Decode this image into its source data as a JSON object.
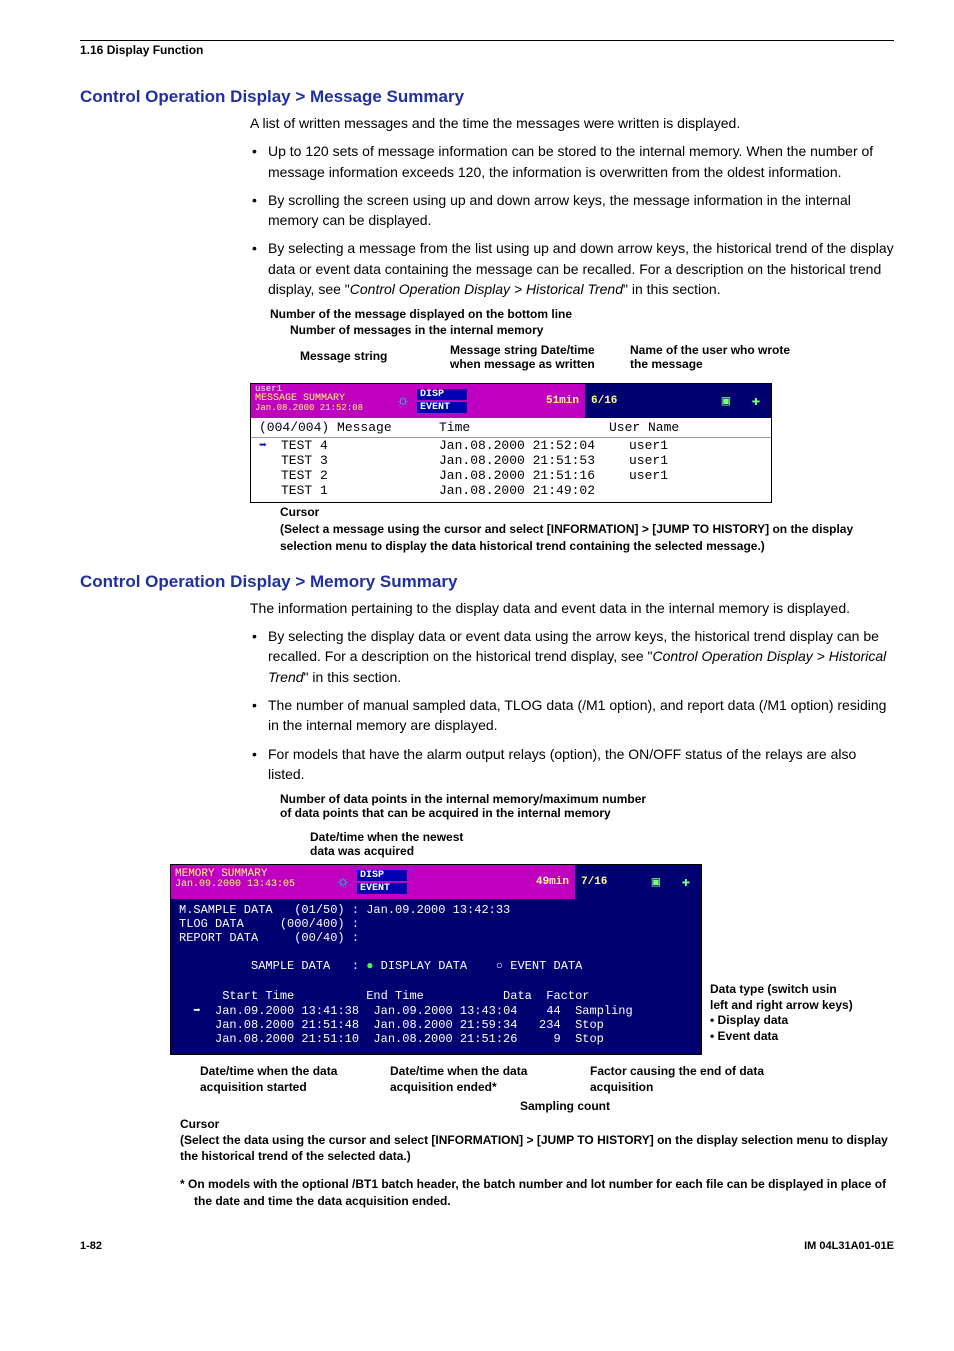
{
  "header": {
    "section": "1.16  Display Function"
  },
  "msg": {
    "heading": "Control Operation Display > Message Summary",
    "intro": "A list of written messages and the time the messages were written is displayed.",
    "bullets": [
      "Up to 120 sets of message information can be stored to the internal memory.  When the number of message information exceeds 120, the information is overwritten from the oldest information.",
      "By scrolling the screen using up and down arrow keys, the message information in the internal memory can be displayed.",
      "By selecting a message from the list using up and down arrow keys, the historical trend of the display data or event data containing the message can be recalled.  For a description on the historical trend display, see \""
    ],
    "bullet3_ital": "Control Operation Display > Historical Trend",
    "bullet3_tail": "\" in this section.",
    "cap1": "Number of the message displayed on the bottom line",
    "cap2": "Number of messages in the internal memory",
    "lbl_msgstr": "Message string",
    "lbl_dt1": "Message string Date/time",
    "lbl_dt2": "when message as written",
    "lbl_user1": "Name of the user who wrote",
    "lbl_user2": "the message",
    "strip": {
      "user": "user1",
      "title": "MESSAGE SUMMARY",
      "ts": "Jan.08.2000 21:52:08",
      "disp": "DISP",
      "event": "EVENT",
      "elapsed": "51min",
      "page": "6/16"
    },
    "cols": {
      "c1": "(004/004) Message",
      "c2": "Time",
      "c3": "User Name"
    },
    "rows": [
      {
        "arrow": "➡",
        "m": "TEST 4",
        "t": "Jan.08.2000 21:52:04",
        "u": "user1"
      },
      {
        "arrow": "",
        "m": "TEST 3",
        "t": "Jan.08.2000 21:51:53",
        "u": "user1"
      },
      {
        "arrow": "",
        "m": "TEST 2",
        "t": "Jan.08.2000 21:51:16",
        "u": "user1"
      },
      {
        "arrow": "",
        "m": "TEST 1",
        "t": "Jan.08.2000 21:49:02",
        "u": ""
      }
    ],
    "cursor": "Cursor",
    "cursor_note": "(Select a message using the cursor and select [INFORMATION] > [JUMP TO HISTORY] on the display selection menu to display the data historical trend containing the selected message.)"
  },
  "mem": {
    "heading": "Control Operation Display > Memory Summary",
    "intro": "The information pertaining to the display data and event data in the internal memory is displayed.",
    "bullets": [
      "By selecting the display data or event data using the arrow keys, the historical trend display can be recalled.  For a description on the historical trend display, see \"",
      "The number of manual sampled data, TLOG data (/M1 option), and report data (/M1 option) residing in the internal memory are displayed.",
      "For models that have the alarm output relays (option), the ON/OFF status of the relays are also listed."
    ],
    "bullet1_ital": "Control Operation Display > Historical Trend",
    "bullet1_tail": "\" in this section.",
    "cap_top1": "Number of data points in the internal memory/maximum number",
    "cap_top2": "of data points that can be acquired in the internal memory",
    "cap_date1": "Date/time when the newest",
    "cap_date2": "data was acquired",
    "strip": {
      "title": "MEMORY SUMMARY",
      "ts": "Jan.09.2000 13:43:05",
      "disp": "DISP",
      "event": "EVENT",
      "elapsed": "49min",
      "page": "7/16"
    },
    "lines": {
      "l1a": "M.SAMPLE DATA   (01/50) : Jan.09.2000 13:42:33",
      "l2": "TLOG DATA     (000/400) :",
      "l3": "REPORT DATA     (00/40) :",
      "l4a": "SAMPLE DATA   : ",
      "l4b": "DISPLAY DATA",
      "l4c": "    ",
      "l4d": "EVENT DATA",
      "hdr": "      Start Time          End Time           Data  Factor",
      "r1": "  ➡  Jan.09.2000 13:41:38  Jan.09.2000 13:43:04    44  Sampling",
      "r2": "     Jan.08.2000 21:51:48  Jan.08.2000 21:59:34   234  Stop",
      "r3": "     Jan.08.2000 21:51:10  Jan.08.2000 21:51:26     9  Stop"
    },
    "side": {
      "a1": "Data type (switch usin",
      "a2": "left and right arrow keys)",
      "a3": "• Display data",
      "a4": "• Event data"
    },
    "annot": {
      "c1a": "Date/time when the data",
      "c1b": "acquisition started",
      "c2a": "Date/time when the data",
      "c2b": "acquisition ended*",
      "c3a": "Factor causing the end of data",
      "c3b": "acquisition",
      "samp": "Sampling count",
      "cursor": "Cursor",
      "note": "(Select the data using the cursor and select [INFORMATION] > [JUMP TO HISTORY] on the display selection menu to display the historical trend of the selected data.)"
    },
    "footnote": "*    On models with the optional /BT1 batch header, the batch number and lot number for each file can be displayed in place of the date and time the data acquisition ended."
  },
  "footer": {
    "page": "1-82",
    "doc": "IM 04L31A01-01E"
  }
}
